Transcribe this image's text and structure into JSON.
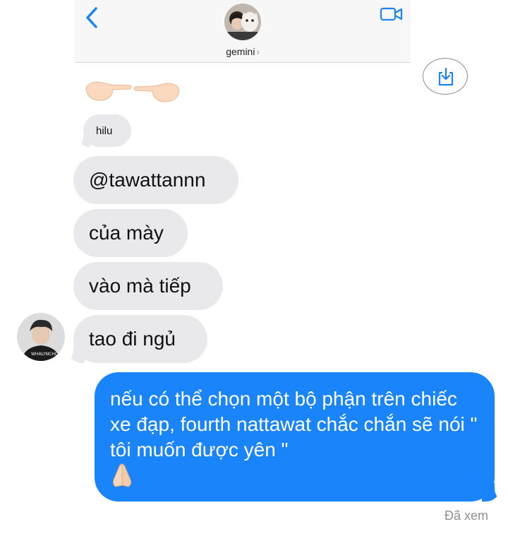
{
  "header": {
    "contact_name": "gemini",
    "chevron": "›",
    "back_icon": "chevron-left-icon",
    "video_icon": "video-camera-icon",
    "accent_color": "#1a84fb"
  },
  "save_button": {
    "icon": "download-tray-icon"
  },
  "messages": {
    "emoji": "👉👈",
    "small": "hilu",
    "m1": "@tawattannn",
    "m2": "của mày",
    "m3": "vào mà tiếp",
    "m4": "tao đi ngủ",
    "sent": "nếu có thể chọn một bộ phận trên chiếc xe đạp, fourth nattawat chắc chắn sẽ nói \" tôi muốn được yên \"",
    "sent_emoji": "🙏"
  },
  "status": {
    "seen": "Đã xem"
  },
  "colors": {
    "sent_bubble": "#1a84fb",
    "received_bubble": "#e9e9eb"
  }
}
